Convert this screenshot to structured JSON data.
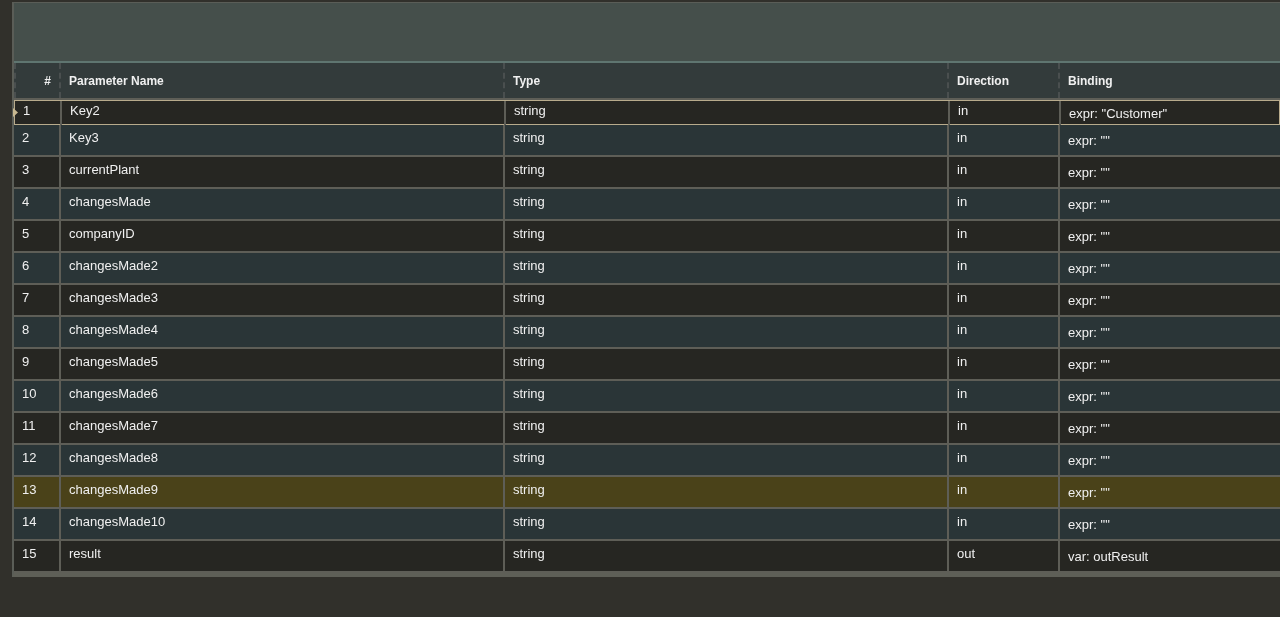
{
  "table": {
    "columns": [
      "#",
      "Parameter Name",
      "Type",
      "Direction",
      "Binding"
    ],
    "rows": [
      {
        "index": "1",
        "name": "Key2",
        "type": "string",
        "direction": "in",
        "binding": "expr: \"Customer\"",
        "current": true,
        "selected": false
      },
      {
        "index": "2",
        "name": "Key3",
        "type": "string",
        "direction": "in",
        "binding": "expr: \"\"",
        "current": false,
        "selected": false
      },
      {
        "index": "3",
        "name": "currentPlant",
        "type": "string",
        "direction": "in",
        "binding": "expr: \"\"",
        "current": false,
        "selected": false
      },
      {
        "index": "4",
        "name": "changesMade",
        "type": "string",
        "direction": "in",
        "binding": "expr: \"\"",
        "current": false,
        "selected": false
      },
      {
        "index": "5",
        "name": "companyID",
        "type": "string",
        "direction": "in",
        "binding": "expr: \"\"",
        "current": false,
        "selected": false
      },
      {
        "index": "6",
        "name": "changesMade2",
        "type": "string",
        "direction": "in",
        "binding": "expr: \"\"",
        "current": false,
        "selected": false
      },
      {
        "index": "7",
        "name": "changesMade3",
        "type": "string",
        "direction": "in",
        "binding": "expr: \"\"",
        "current": false,
        "selected": false
      },
      {
        "index": "8",
        "name": "changesMade4",
        "type": "string",
        "direction": "in",
        "binding": "expr: \"\"",
        "current": false,
        "selected": false
      },
      {
        "index": "9",
        "name": "changesMade5",
        "type": "string",
        "direction": "in",
        "binding": "expr: \"\"",
        "current": false,
        "selected": false
      },
      {
        "index": "10",
        "name": "changesMade6",
        "type": "string",
        "direction": "in",
        "binding": "expr: \"\"",
        "current": false,
        "selected": false
      },
      {
        "index": "11",
        "name": "changesMade7",
        "type": "string",
        "direction": "in",
        "binding": "expr: \"\"",
        "current": false,
        "selected": false
      },
      {
        "index": "12",
        "name": "changesMade8",
        "type": "string",
        "direction": "in",
        "binding": "expr: \"\"",
        "current": false,
        "selected": false
      },
      {
        "index": "13",
        "name": "changesMade9",
        "type": "string",
        "direction": "in",
        "binding": "expr: \"\"",
        "current": false,
        "selected": true
      },
      {
        "index": "14",
        "name": "changesMade10",
        "type": "string",
        "direction": "in",
        "binding": "expr: \"\"",
        "current": false,
        "selected": false
      },
      {
        "index": "15",
        "name": "result",
        "type": "string",
        "direction": "out",
        "binding": "var: outResult",
        "current": false,
        "selected": false
      }
    ]
  }
}
